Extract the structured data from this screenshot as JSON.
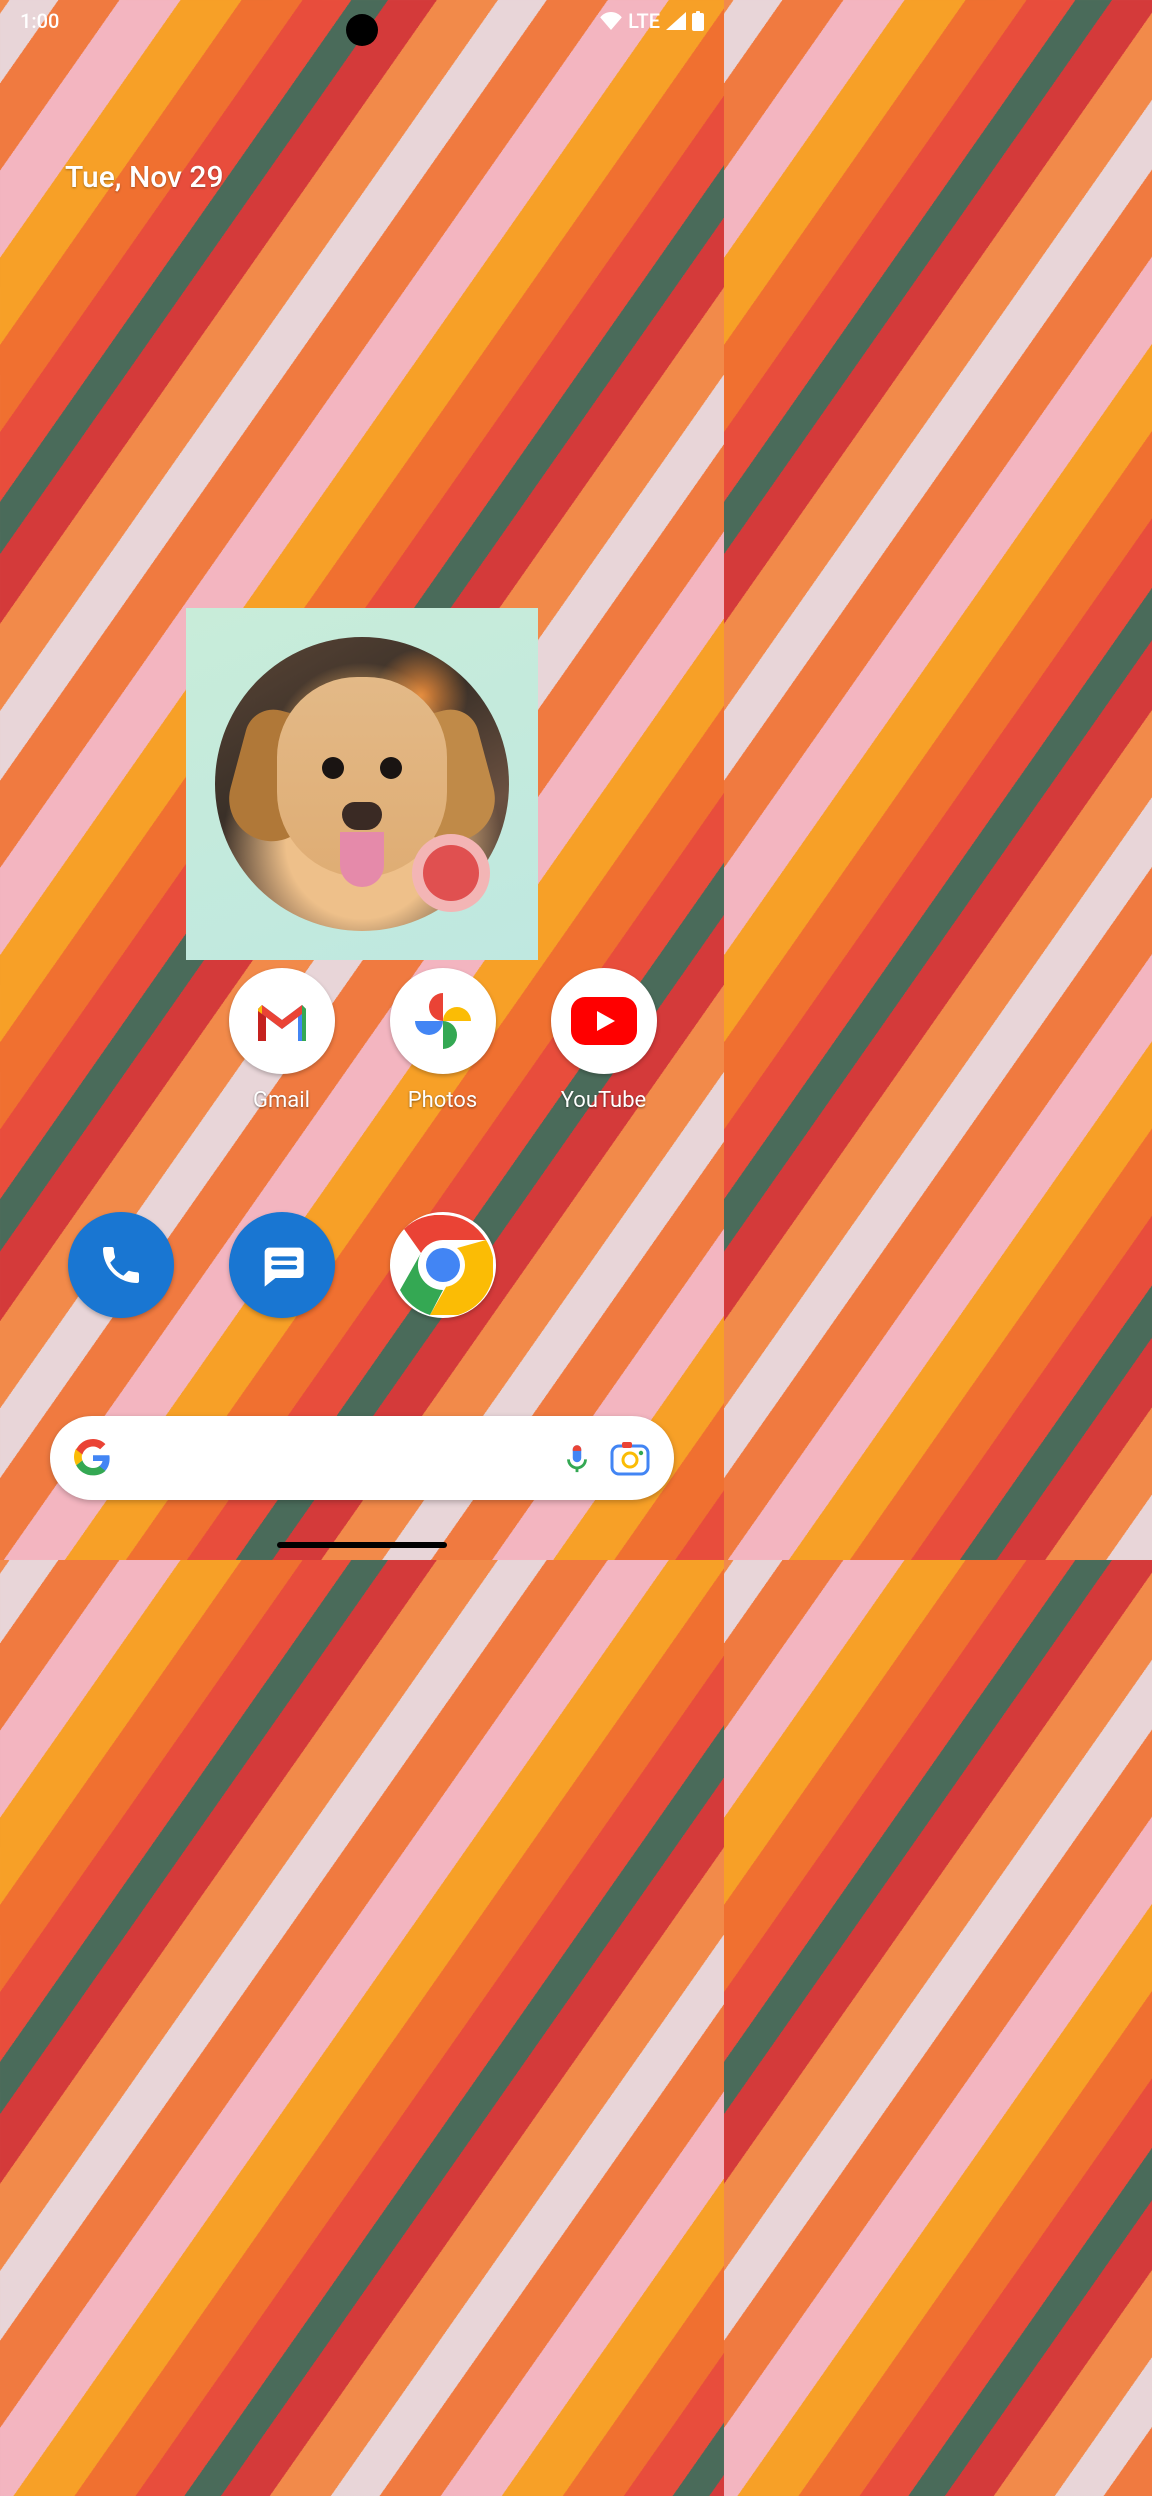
{
  "status": {
    "time": "1:00",
    "network_label": "LTE"
  },
  "date_widget": {
    "text": "Tue, Nov 29"
  },
  "contact_widget": {
    "photo_description": "golden retriever dog"
  },
  "apps": [
    {
      "label": "",
      "icon": "blank"
    },
    {
      "label": "Gmail",
      "icon": "gmail"
    },
    {
      "label": "Photos",
      "icon": "photos"
    },
    {
      "label": "YouTube",
      "icon": "youtube"
    }
  ],
  "dock": [
    {
      "icon": "phone"
    },
    {
      "icon": "messages"
    },
    {
      "icon": "chrome"
    },
    {
      "icon": "blank"
    }
  ],
  "search": {
    "logo": "google",
    "voice_icon": "mic",
    "lens_icon": "camera-lens"
  }
}
